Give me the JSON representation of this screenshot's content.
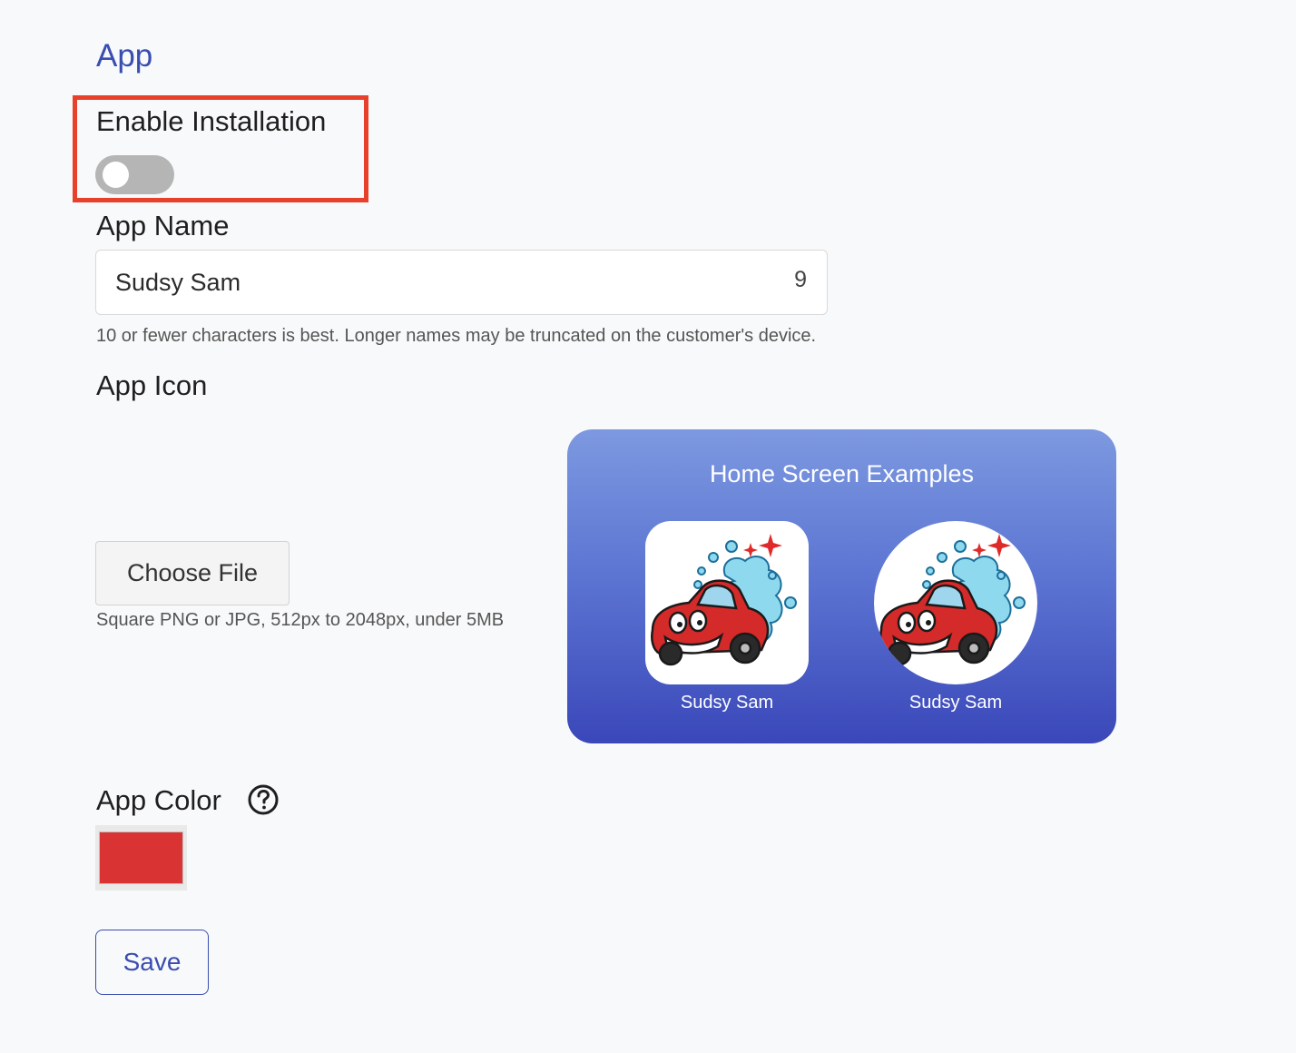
{
  "section": {
    "title": "App"
  },
  "enable_installation": {
    "label": "Enable Installation",
    "enabled": false
  },
  "app_name": {
    "label": "App Name",
    "value": "Sudsy Sam",
    "char_count": "9",
    "helper": "10 or fewer characters is best. Longer names may be truncated on the customer's device."
  },
  "app_icon": {
    "label": "App Icon",
    "choose_file_label": "Choose File",
    "helper": "Square PNG or JPG, 512px to 2048px, under 5MB"
  },
  "preview": {
    "title": "Home Screen Examples",
    "examples": [
      {
        "shape": "rounded-square",
        "caption": "Sudsy Sam"
      },
      {
        "shape": "circle",
        "caption": "Sudsy Sam"
      }
    ]
  },
  "app_color": {
    "label": "App Color",
    "value": "#d93333",
    "help_icon": "question-circle-icon"
  },
  "actions": {
    "save_label": "Save"
  },
  "colors": {
    "accent": "#3a4db0",
    "highlight": "#e8412b",
    "toggle_off": "#b5b5b5"
  }
}
